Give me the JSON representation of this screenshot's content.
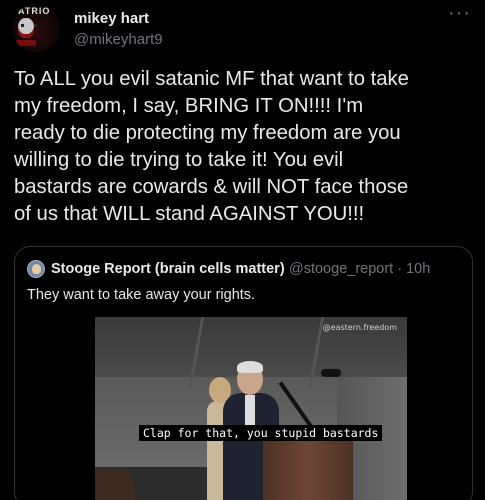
{
  "author": {
    "display_name": "mikey hart",
    "handle": "@mikeyhart9",
    "avatar_text": "ATRIO"
  },
  "more_label": "···",
  "tweet_text": "To ALL you evil satanic MF that want to take\nmy freedom, I say, BRING IT ON!!!!  I'm\nready to die protecting my freedom are you\nwilling to die trying to take it!  You evil\nbastards are cowards & will NOT face those\nof us that WILL stand AGAINST YOU!!!",
  "quoted_tweet": {
    "display_name": "Stooge Report (brain cells matter)",
    "handle_time": "@stooge_report · 10h",
    "text": "They want to take away your rights.",
    "video": {
      "watermark": "@eastern.freedom",
      "caption": "Clap for that, you stupid bastards"
    }
  },
  "colors": {
    "background": "#000000",
    "primary_text": "#e7e9ea",
    "secondary_text": "#71767b",
    "border": "#2f3336"
  }
}
